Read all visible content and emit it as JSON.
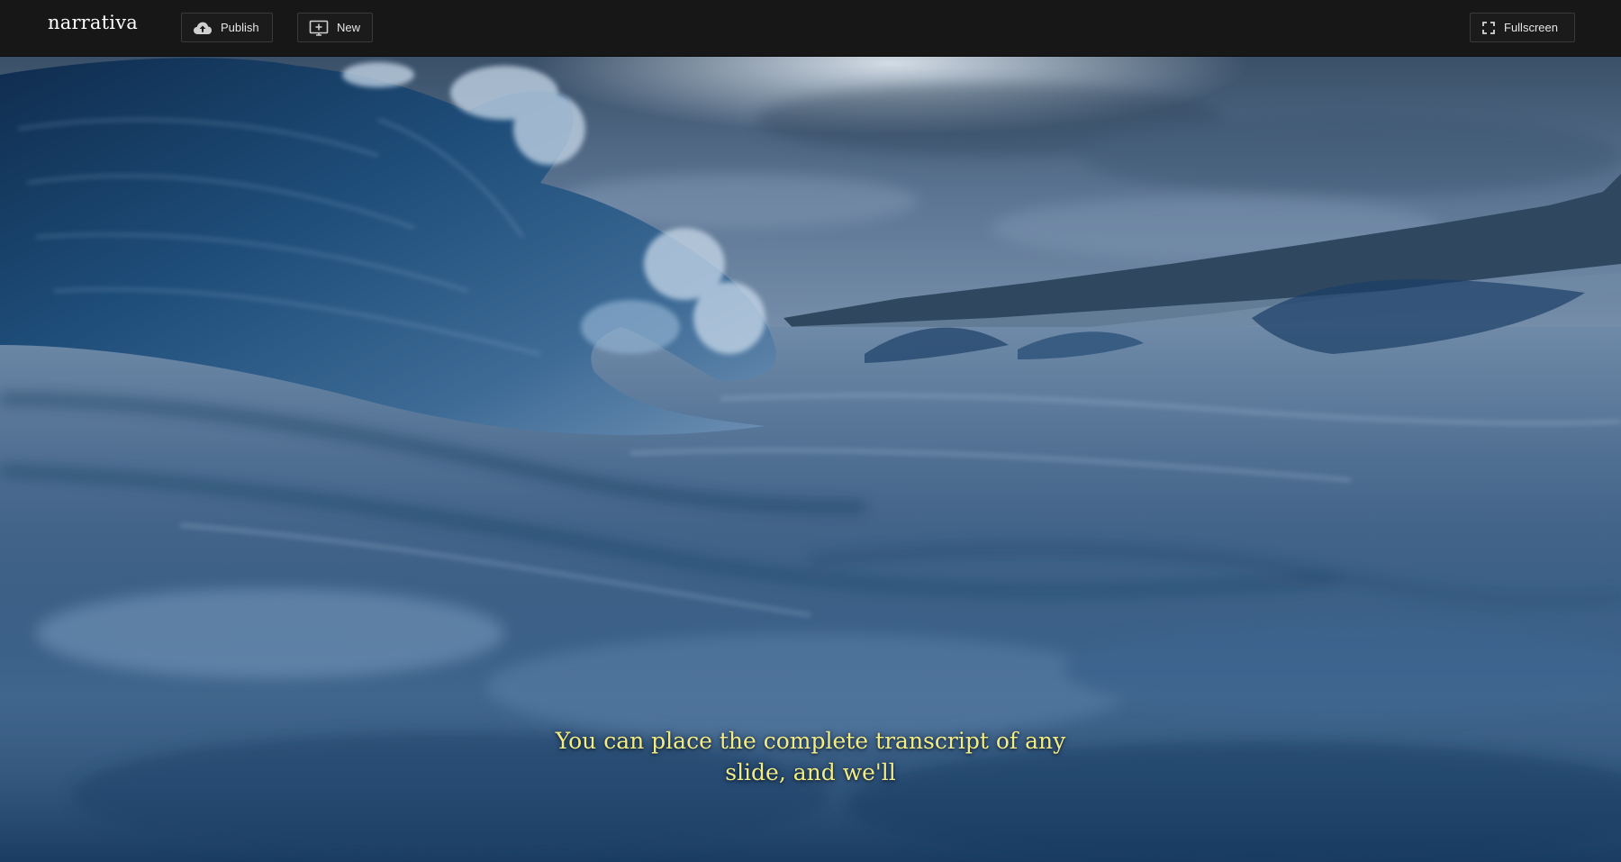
{
  "app": {
    "logo": "narrativa"
  },
  "toolbar": {
    "publish_label": "Publish",
    "new_label": "New",
    "fullscreen_label": "Fullscreen",
    "publish_icon": "cloud-upload-icon",
    "new_icon": "new-slide-icon",
    "fullscreen_icon": "fullscreen-icon"
  },
  "slide": {
    "background": "ocean-wave-photo",
    "caption": "You can place the complete transcript of any slide, and we'll",
    "caption_color": "#f2ec86"
  },
  "colors": {
    "topbar": "#171717",
    "button_border": "#3a3a3a",
    "button_text": "#e6e6e6"
  }
}
